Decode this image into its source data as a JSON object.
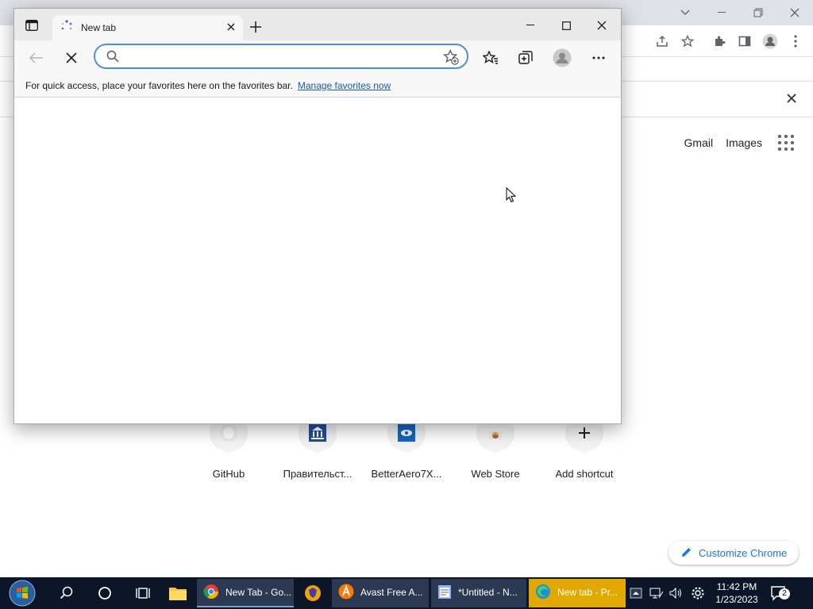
{
  "chrome": {
    "links": {
      "gmail": "Gmail",
      "images": "Images"
    },
    "shortcuts": [
      {
        "title": "GitHub",
        "icon": "github-icon"
      },
      {
        "title": "Правительст...",
        "icon": "government-site-icon"
      },
      {
        "title": "BetterAero7X...",
        "icon": "betteraero-icon"
      },
      {
        "title": "Web Store",
        "icon": "chrome-webstore-icon"
      },
      {
        "title": "Add shortcut",
        "icon": "plus-icon"
      }
    ],
    "customize_label": "Customize Chrome"
  },
  "edge": {
    "tab_title": "New tab",
    "address_value": "",
    "favorites_bar_text": "For quick access, place your favorites here on the favorites bar.",
    "manage_favorites_label": "Manage favorites now"
  },
  "taskbar": {
    "apps": [
      {
        "label": "New Tab - Go...",
        "icon": "chrome-icon"
      },
      {
        "label": "",
        "icon": "brave-icon"
      },
      {
        "label": "Avast Free A...",
        "icon": "avast-icon"
      },
      {
        "label": "*Untitled - N...",
        "icon": "notepad-icon"
      },
      {
        "label": "New tab - Pr...",
        "icon": "edge-icon"
      }
    ],
    "clock": {
      "time": "11:42 PM",
      "date": "1/23/2023"
    },
    "notification_count": "2"
  },
  "colors": {
    "accent_blue": "#1a73e8",
    "edge_focus_border": "#4e8ed6",
    "taskbar_bg": "#0d1628",
    "taskbar_active_app": "#e0a800"
  }
}
